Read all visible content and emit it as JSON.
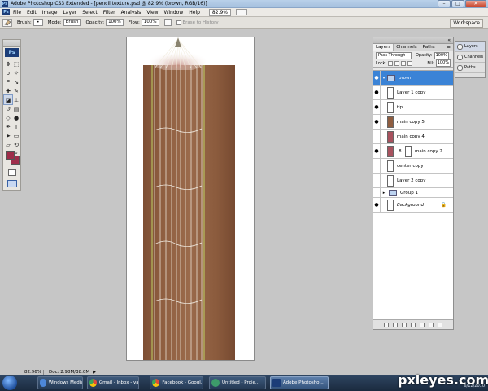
{
  "window": {
    "title": "Adobe Photoshop CS3 Extended - [pencil texture.psd @ 82.9% (brown, RGB/16)]"
  },
  "menubar": {
    "app_badge": "Ps",
    "items": [
      "File",
      "Edit",
      "Image",
      "Layer",
      "Select",
      "Filter",
      "Analysis",
      "View",
      "Window",
      "Help"
    ],
    "zoom": "82.9%"
  },
  "options": {
    "brush_label": "Brush:",
    "mode_label": "Mode:",
    "mode_value": "Brush",
    "opacity_label": "Opacity:",
    "opacity_value": "100%",
    "flow_label": "Flow:",
    "flow_value": "100%",
    "erase_history": "Erase to History",
    "workspace": "Workspace"
  },
  "toolbox": {
    "ps_label": "Ps",
    "foreground_color": "#9e2d4a",
    "background_color": "#9e2d4a"
  },
  "status": {
    "zoom": "82.96%",
    "doc": "Doc: 2.98M/38.0M"
  },
  "layers_panel": {
    "tabs": [
      "Layers",
      "Channels",
      "Paths"
    ],
    "blend_mode": "Pass Through",
    "opacity_label": "Opacity:",
    "opacity_value": "100%",
    "lock_label": "Lock:",
    "fill_label": "Fill:",
    "fill_value": "100%",
    "layers": [
      {
        "name": "brown",
        "kind": "folder",
        "selected": true,
        "visible": true
      },
      {
        "name": "Layer 1 copy",
        "kind": "layer",
        "visible": true
      },
      {
        "name": "tip",
        "kind": "layer",
        "visible": true
      },
      {
        "name": "main copy 5",
        "kind": "brown",
        "visible": true
      },
      {
        "name": "main copy 4",
        "kind": "red",
        "visible": false
      },
      {
        "name": "main copy 2",
        "kind": "red-mask",
        "visible": true
      },
      {
        "name": "center copy",
        "kind": "layer",
        "visible": false
      },
      {
        "name": "Layer 2 copy",
        "kind": "layer",
        "visible": false
      },
      {
        "name": "Group 1",
        "kind": "group",
        "visible": false
      },
      {
        "name": "Background",
        "kind": "background",
        "visible": true
      }
    ]
  },
  "dock": {
    "items": [
      "Layers",
      "Channels",
      "Paths"
    ]
  },
  "taskbar": {
    "items": [
      "Windows Media P...",
      "Gmail - Inbox - va...",
      "Facebook - Googl...",
      "Untitled - Proje...",
      "Adobe Photosho..."
    ],
    "date": "6/12/2010"
  },
  "watermark": "pxleyes.com"
}
